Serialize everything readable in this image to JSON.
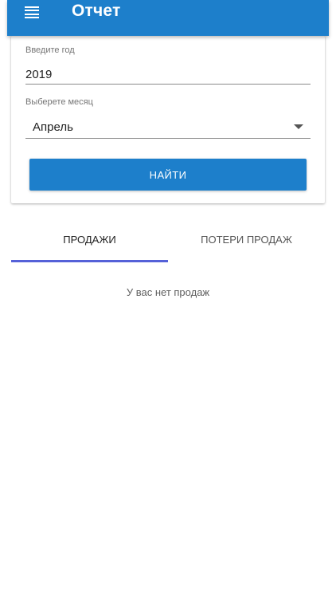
{
  "app_bar": {
    "title": "Отчет",
    "menu_icon": "menu-icon",
    "color": "#1d7fcb"
  },
  "form": {
    "year": {
      "label": "Введите год",
      "value": "2019"
    },
    "month": {
      "label": "Выберете месяц",
      "selected": "Апрель",
      "icon": "dropdown-arrow-icon"
    },
    "find_button": {
      "label": "НАЙТИ",
      "color": "#1d7fcb"
    }
  },
  "tabs": {
    "items": [
      {
        "label": "ПРОДАЖИ",
        "active": true
      },
      {
        "label": "ПОТЕРИ ПРОДАЖ",
        "active": false
      }
    ],
    "indicator_color": "#5561d8"
  },
  "content": {
    "empty_message": "У вас нет продаж"
  }
}
